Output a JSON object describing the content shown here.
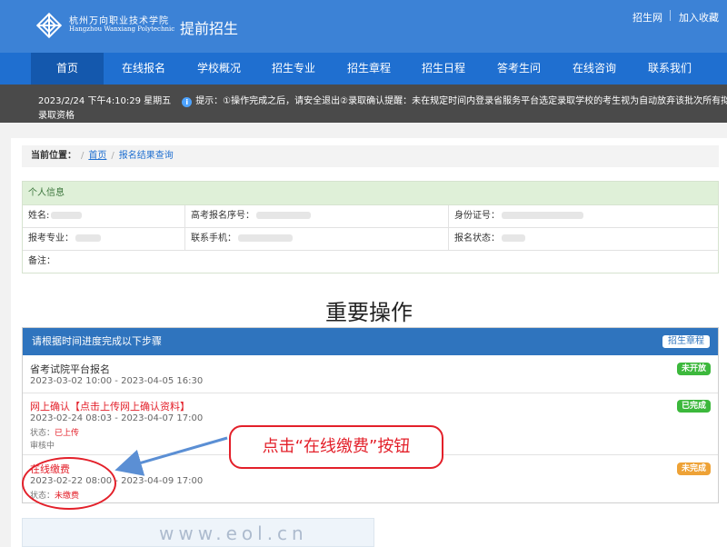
{
  "header": {
    "school_cn": "杭州万向职业技术学院",
    "school_en": "Hangzhou Wanxiang Polytechnic",
    "site_title": "提前招生",
    "links": [
      "招生网",
      "加入收藏"
    ],
    "brand_color": "#3c82d6"
  },
  "nav": {
    "items": [
      "首页",
      "在线报名",
      "学校概况",
      "招生专业",
      "招生章程",
      "招生日程",
      "答考生问",
      "在线咨询",
      "联系我们"
    ],
    "active": "首页"
  },
  "notice": {
    "datetime": "2023/2/24 下午4:10:29 星期五",
    "line1": "提示：①操作完成之后，请安全退出②录取确认提醒：未在规定时间内登录省服务平台选定录取学校的考生视为自动放弃该批次所有拟",
    "line2": "录取资格"
  },
  "breadcrumb": {
    "label": "当前位置：",
    "home": "首页",
    "current": "报名结果查询"
  },
  "personal_info": {
    "title": "个人信息",
    "name_label": "姓名:",
    "exam_no_label": "高考报名序号：",
    "id_label": "身份证号：",
    "major_label": "报考专业：",
    "phone_label": "联系手机：",
    "status_label": "报名状态：",
    "remark_label": "备注："
  },
  "operations": {
    "title": "重要操作",
    "header": "请根据时间进度完成以下步骤",
    "header_button": "招生章程",
    "steps": [
      {
        "title": "省考试院平台报名",
        "date": "2023-03-02 10:00 - 2023-04-05 16:30",
        "badge": "未开放"
      },
      {
        "title": "网上确认【点击上传网上确认资料】",
        "date": "2023-02-24 08:03 - 2023-04-07 17:00",
        "status_label": "状态：",
        "status_value": "已上传",
        "extra": "审核中",
        "badge": "已完成"
      },
      {
        "title": "在线缴费",
        "date": "2023-02-22 08:00 - 2023-04-09 17:00",
        "status_label": "状态：",
        "status_value": "未缴费",
        "badge": "未完成"
      }
    ]
  },
  "annotation": {
    "callout": "点击“在线缴费”按钮",
    "color": "#e3202a"
  },
  "watermark": "www.eol.cn"
}
